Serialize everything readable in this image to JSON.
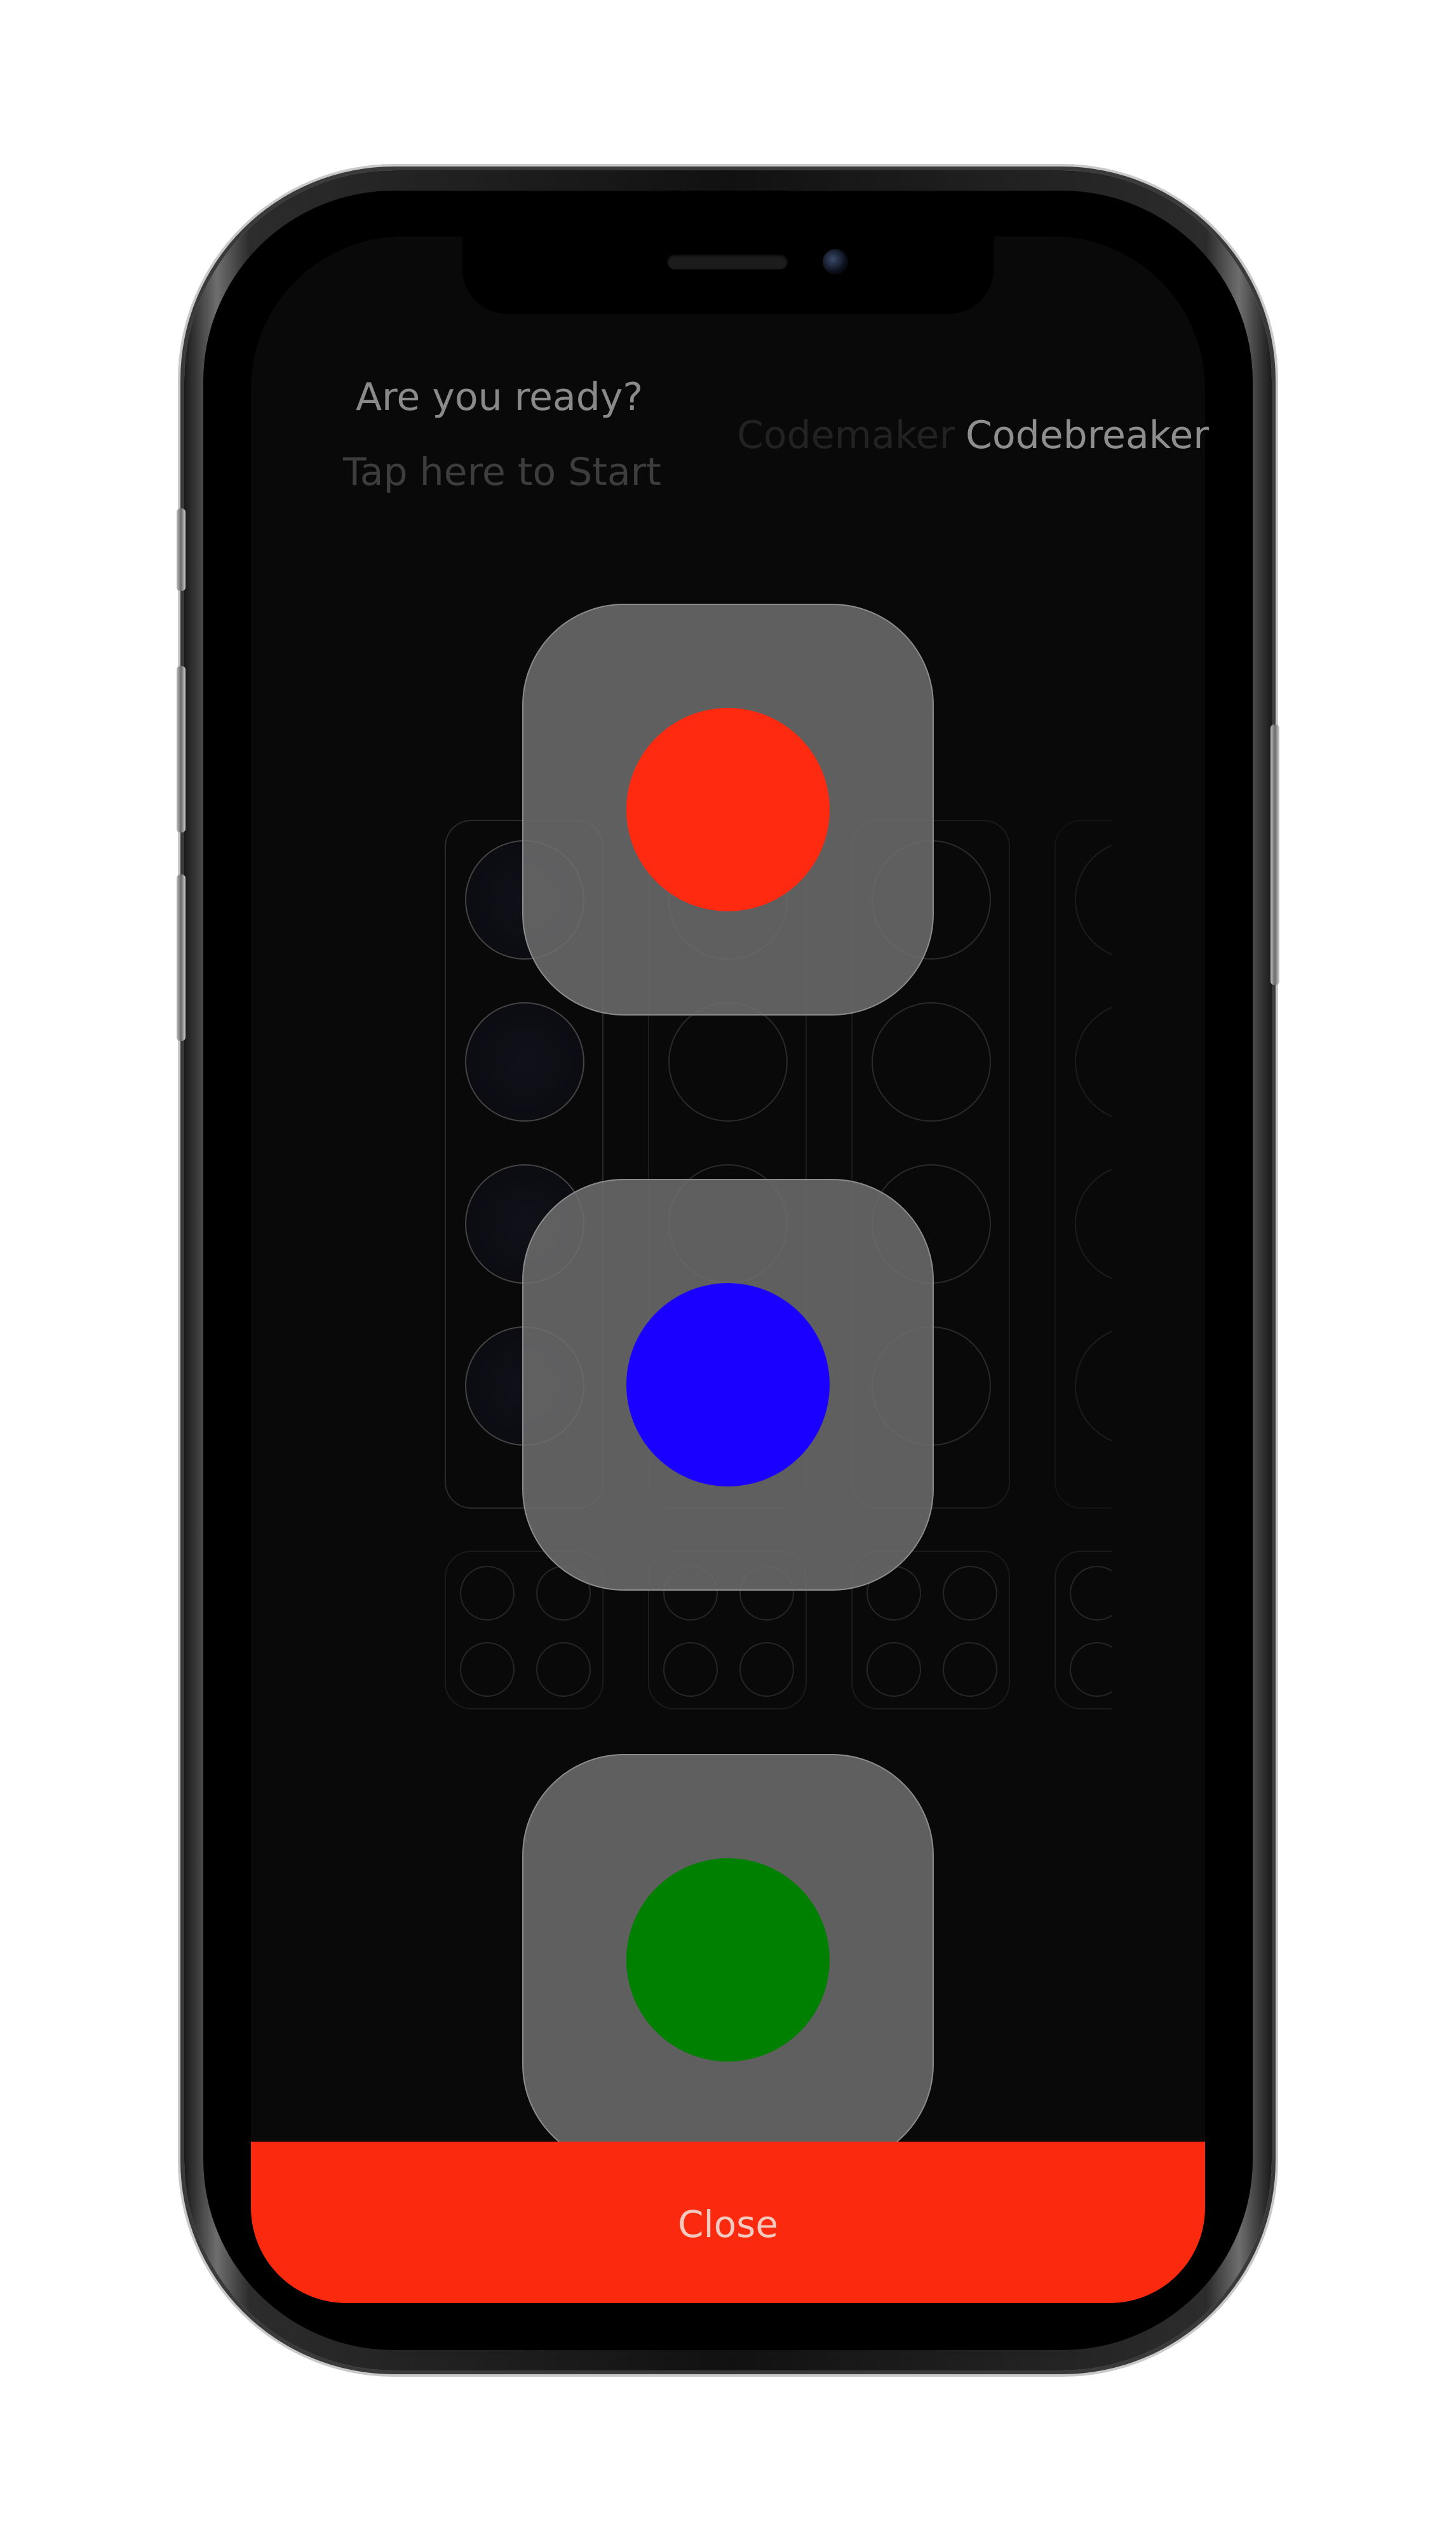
{
  "game": {
    "status_title": "Are you ready?",
    "start_prompt": "Tap here to Start"
  },
  "modes": {
    "maker_label": "Codemaker",
    "breaker_label": "Codebreaker",
    "selected": "Codebreaker"
  },
  "board": {
    "columns": 4,
    "slots_per_column": 4,
    "hint_pegs_per_column": 4
  },
  "color_picker": {
    "options": [
      {
        "name": "red",
        "color": "#ff2a10"
      },
      {
        "name": "blue",
        "color": "#1a00ff"
      },
      {
        "name": "green",
        "color": "#008000"
      }
    ]
  },
  "footer": {
    "close_label": "Close",
    "close_color": "#fb2a0e"
  }
}
